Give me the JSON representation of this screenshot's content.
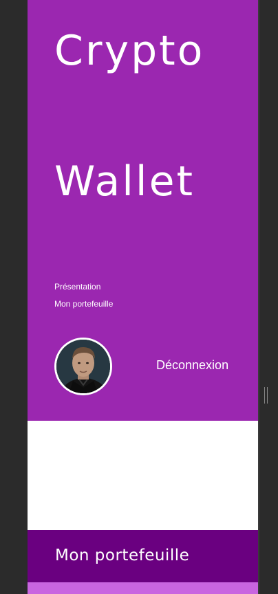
{
  "hero": {
    "title_line1": "Crypto",
    "title_line2": "Wallet",
    "background_color": "#9b27b0"
  },
  "nav": {
    "items": [
      {
        "label": "Présentation"
      },
      {
        "label": "Mon portefeuille"
      }
    ]
  },
  "user": {
    "avatar_icon": "user-avatar",
    "logout_label": "Déconnexion"
  },
  "section": {
    "title": "Mon portefeuille",
    "header_color": "#6a0080",
    "strip_color": "#c965e0"
  }
}
